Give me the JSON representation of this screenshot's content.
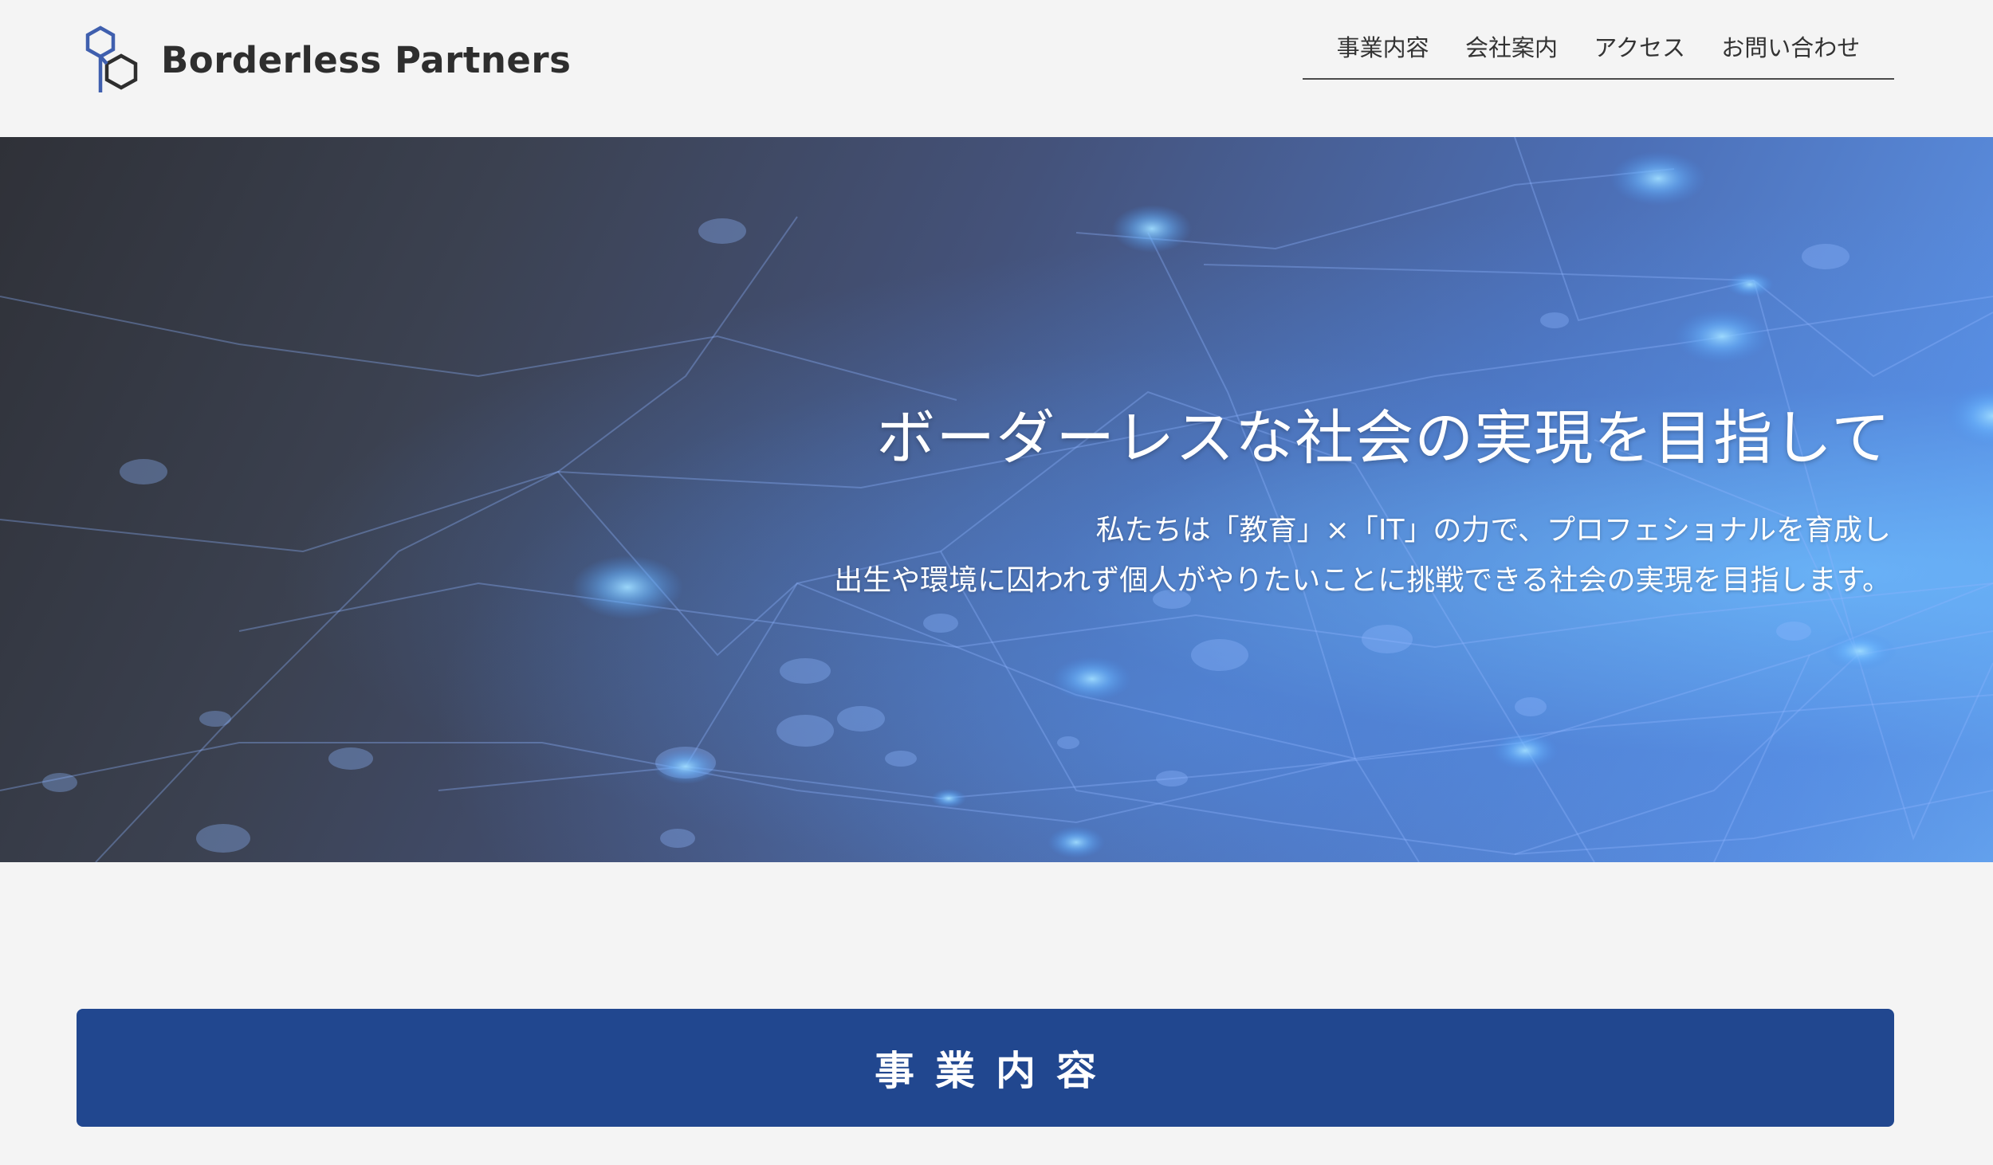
{
  "header": {
    "logo_text": "Borderless Partners",
    "nav": [
      {
        "label": "事業内容"
      },
      {
        "label": "会社案内"
      },
      {
        "label": "アクセス"
      },
      {
        "label": "お問い合わせ"
      }
    ]
  },
  "hero": {
    "title": "ボーダーレスな社会の実現を目指して",
    "subtitle_lines": [
      "私たちは「教育」×「IT」の力で、プロフェショナルを育成し",
      "出生や環境に囚われず個人がやりたいことに挑戦できる社会の実現を目指します。"
    ]
  },
  "section": {
    "title": "事業内容"
  },
  "colors": {
    "page_background": "#f4f4f4",
    "section_banner": "#21478f",
    "logo_hexagon": "#3f5fae",
    "text_dark": "#2e2e2e"
  }
}
